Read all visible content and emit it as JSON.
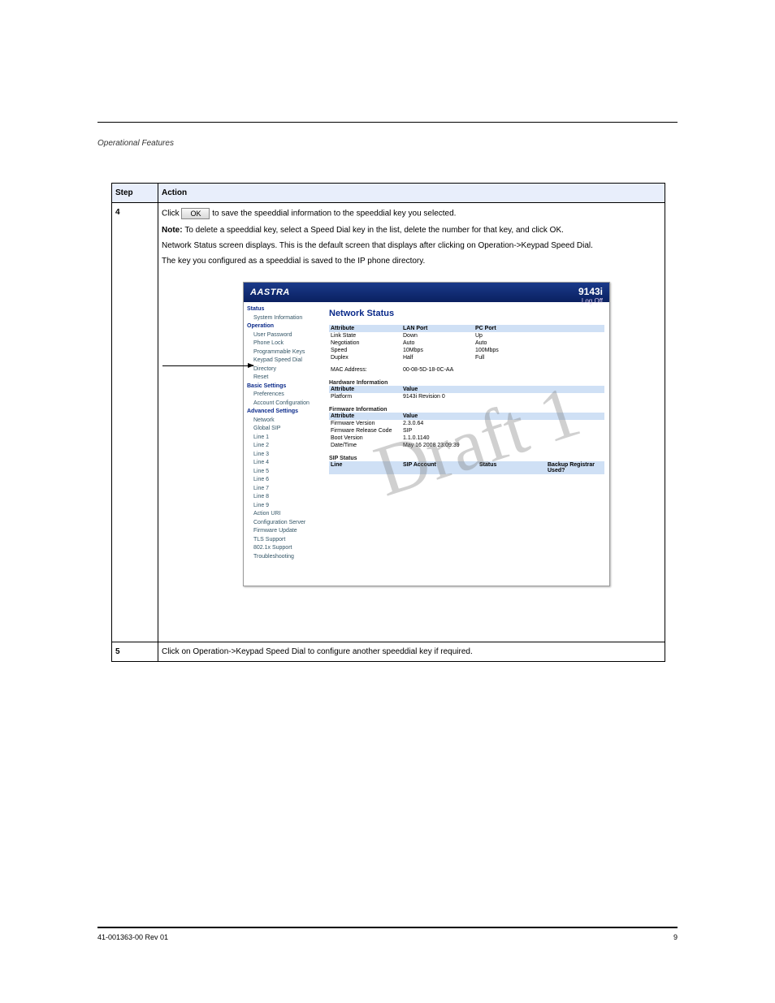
{
  "header": {
    "title": "Operational Features"
  },
  "table": {
    "col1": "Step",
    "col2": "Action",
    "steps": {
      "s4": {
        "num": "4",
        "t1_a": "Click ",
        "t1_b": " to save the speeddial information to the speeddial key you selected.",
        "ok": "OK",
        "note_lead": "Note: ",
        "note_body": "To delete a speeddial key, select a Speed Dial key in the list, delete the number for that key, and click OK.",
        "t2": "Network Status screen displays. This is the default screen that displays after clicking on Operation->Keypad Speed Dial.",
        "t3": "The key you configured as a speeddial is saved to the IP phone directory."
      },
      "s5": {
        "num": "5",
        "body": "Click on Operation->Keypad Speed Dial to configure another speeddial key if required."
      }
    }
  },
  "shot": {
    "logo": "AASTRA",
    "model": "9143i",
    "logoff": "Log Off",
    "nav": {
      "status": "Status",
      "status_items": [
        "System Information"
      ],
      "operation": "Operation",
      "operation_items": [
        "User Password",
        "Phone Lock",
        "Programmable Keys",
        "Keypad Speed Dial",
        "Directory",
        "Reset"
      ],
      "basic": "Basic Settings",
      "basic_items": [
        "Preferences",
        "Account Configuration"
      ],
      "adv": "Advanced Settings",
      "adv_items": [
        "Network",
        "Global SIP",
        "Line 1",
        "Line 2",
        "Line 3",
        "Line 4",
        "Line 5",
        "Line 6",
        "Line 7",
        "Line 8",
        "Line 9",
        "Action URI",
        "Configuration Server",
        "Firmware Update",
        "TLS Support",
        "802.1x Support",
        "Troubleshooting"
      ]
    },
    "main": {
      "title": "Network Status",
      "cols": [
        "Attribute",
        "LAN Port",
        "PC Port"
      ],
      "rows": [
        [
          "Link State",
          "Down",
          "Up"
        ],
        [
          "Negotiation",
          "Auto",
          "Auto"
        ],
        [
          "Speed",
          "10Mbps",
          "100Mbps"
        ],
        [
          "Duplex",
          "Half",
          "Full"
        ]
      ],
      "mac_label": "MAC Address:",
      "mac_value": "00-08-5D-18-0C-AA",
      "hw_title": "Hardware Information",
      "hw_cols": [
        "Attribute",
        "Value"
      ],
      "hw_rows": [
        [
          "Platform",
          "9143i Revision 0"
        ]
      ],
      "fw_title": "Firmware Information",
      "fw_cols": [
        "Attribute",
        "Value"
      ],
      "fw_rows": [
        [
          "Firmware Version",
          "2.3.0.64"
        ],
        [
          "Firmware Release Code",
          "SIP"
        ],
        [
          "Boot Version",
          "1.1.0.1140"
        ],
        [
          "Date/Time",
          "May 16 2008 23:09:39"
        ]
      ],
      "sip_title": "SIP Status",
      "sip_cols": [
        "Line",
        "SIP Account",
        "Status",
        "Backup Registrar Used?"
      ]
    },
    "watermark": "Draft 1"
  },
  "footer": {
    "left": "41-001363-00 Rev 01",
    "right": "9"
  }
}
